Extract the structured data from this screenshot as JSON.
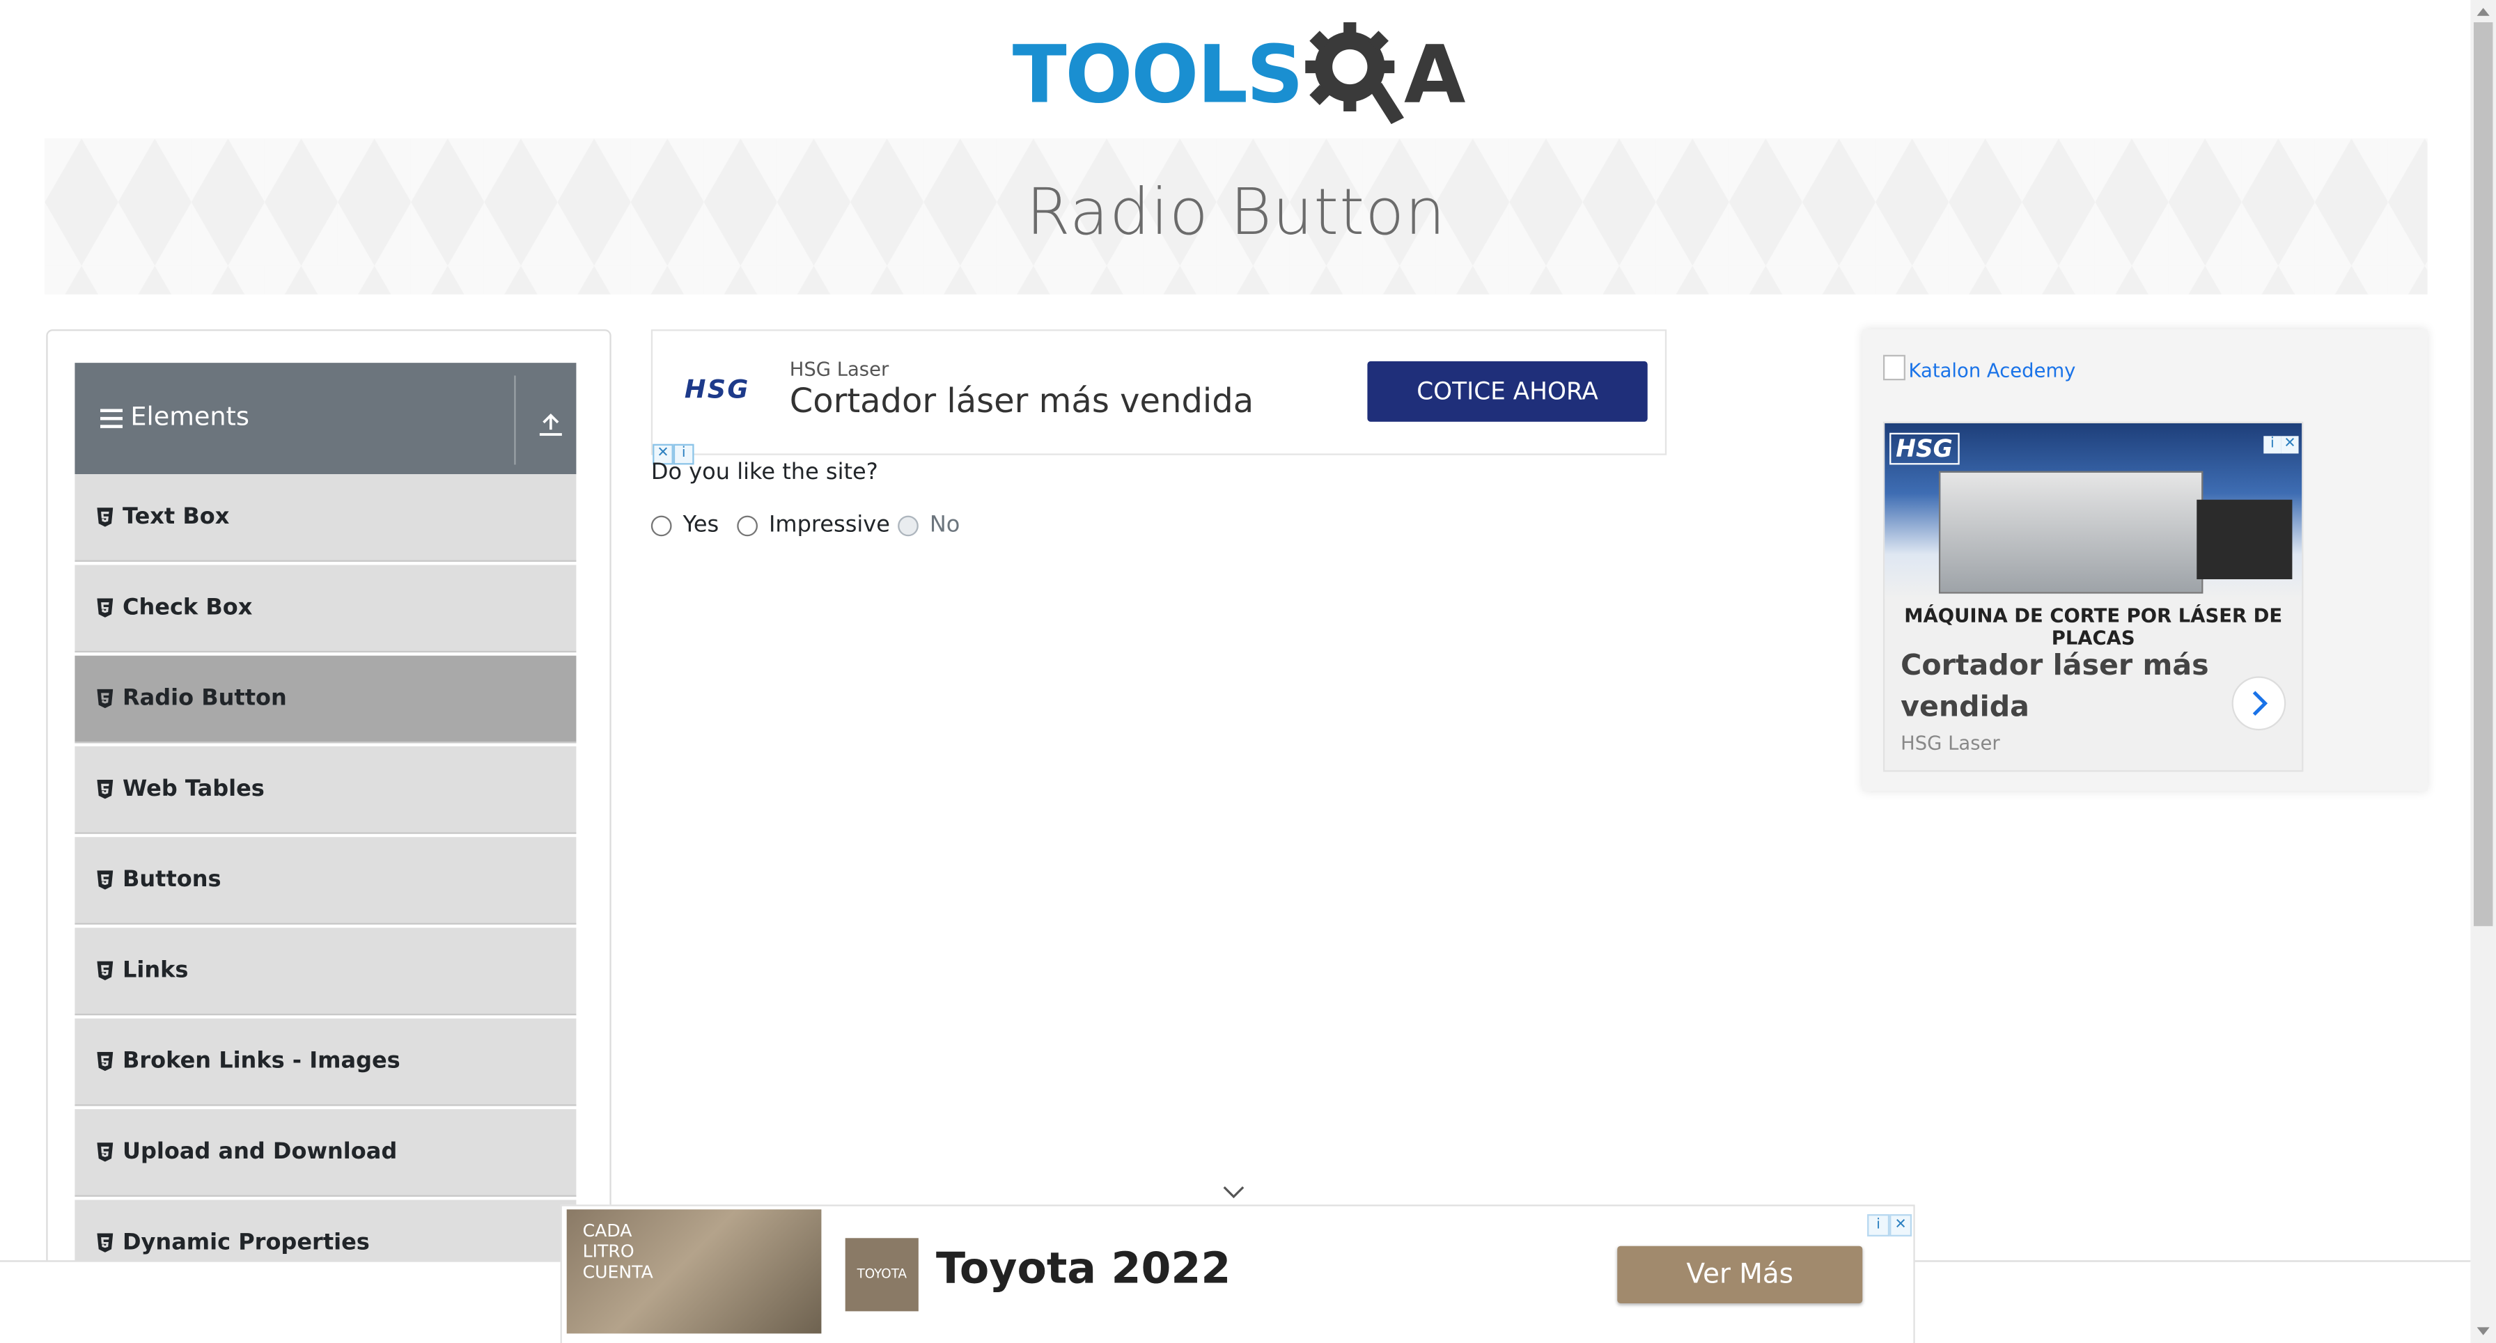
{
  "header": {
    "logo_text": "TOOLS",
    "logo_tail": "A"
  },
  "banner": {
    "title": "Radio Button"
  },
  "sidebar": {
    "group_title": "Elements",
    "items": [
      {
        "label": "Text Box"
      },
      {
        "label": "Check Box"
      },
      {
        "label": "Radio Button",
        "active": true
      },
      {
        "label": "Web Tables"
      },
      {
        "label": "Buttons"
      },
      {
        "label": "Links"
      },
      {
        "label": "Broken Links - Images"
      },
      {
        "label": "Upload and Download"
      },
      {
        "label": "Dynamic Properties"
      }
    ]
  },
  "ad_top": {
    "brand": "HSG",
    "advertiser": "HSG Laser",
    "headline": "Cortador láser más vendida",
    "cta": "COTICE AHORA"
  },
  "main": {
    "question": "Do you like the site?",
    "options": [
      {
        "label": "Yes",
        "disabled": false
      },
      {
        "label": "Impressive",
        "disabled": false
      },
      {
        "label": "No",
        "disabled": true
      }
    ]
  },
  "ad_right": {
    "broken_image_alt": "Katalon Acedemy",
    "image_brand": "HSG",
    "caption": "MÁQUINA DE CORTE POR LÁSER DE PLACAS",
    "headline": "Cortador láser más vendida",
    "advertiser": "HSG Laser"
  },
  "ad_bottom": {
    "tile_text": "CADA\nLITRO\nCUENTA",
    "thumb_text": "TOYOTA",
    "title": "Toyota 2022",
    "cta": "Ver Más"
  },
  "colors": {
    "logo_blue": "#1a8fd1",
    "group_header": "#6c757d",
    "menu_bg": "#dedede",
    "menu_active": "#a9a9a9",
    "ad_cta_blue": "#1f2f7a",
    "toyota_cta": "#a18a6d"
  }
}
